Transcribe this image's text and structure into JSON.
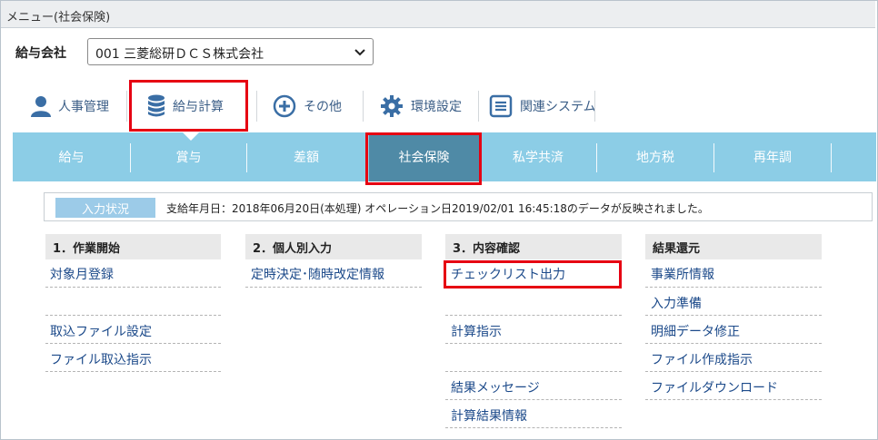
{
  "window": {
    "title": "メニュー(社会保険)"
  },
  "company": {
    "label": "給与会社",
    "selected": "001 三菱総研ＤＣＳ株式会社"
  },
  "top_menu": [
    {
      "label": "人事管理",
      "icon": "person-icon"
    },
    {
      "label": "給与計算",
      "icon": "database-icon",
      "highlighted": true
    },
    {
      "label": "その他",
      "icon": "plus-circle-icon"
    },
    {
      "label": "環境設定",
      "icon": "gear-icon"
    },
    {
      "label": "関連システム",
      "icon": "list-icon"
    }
  ],
  "tabs": [
    {
      "label": "給与"
    },
    {
      "label": "賞与"
    },
    {
      "label": "差額"
    },
    {
      "label": "社会保険",
      "active": true
    },
    {
      "label": "私学共済"
    },
    {
      "label": "地方税"
    },
    {
      "label": "再年調"
    }
  ],
  "status": {
    "badge": "入力状況",
    "message": "支給年月日：2018年06月20日(本処理) オペレーション日2019/02/01 16:45:18のデータが反映されました。"
  },
  "columns": [
    {
      "header": "1．作業開始",
      "links": [
        "対象月登録",
        "",
        "取込ファイル設定",
        "ファイル取込指示"
      ]
    },
    {
      "header": "2．個人別入力",
      "links": [
        "定時決定･随時改定情報"
      ]
    },
    {
      "header": "3．内容確認",
      "links": [
        "チェックリスト出力",
        "",
        "計算指示",
        "",
        "結果メッセージ",
        "計算結果情報"
      ]
    },
    {
      "header": "結果還元",
      "links": [
        "事業所情報",
        "入力準備",
        "明細データ修正",
        "ファイル作成指示",
        "ファイルダウンロード"
      ]
    }
  ],
  "colors": {
    "tab_bar": "#8ccde6",
    "tab_active": "#4f8aa6",
    "link": "#1c4a8a",
    "highlight": "#e60012"
  }
}
